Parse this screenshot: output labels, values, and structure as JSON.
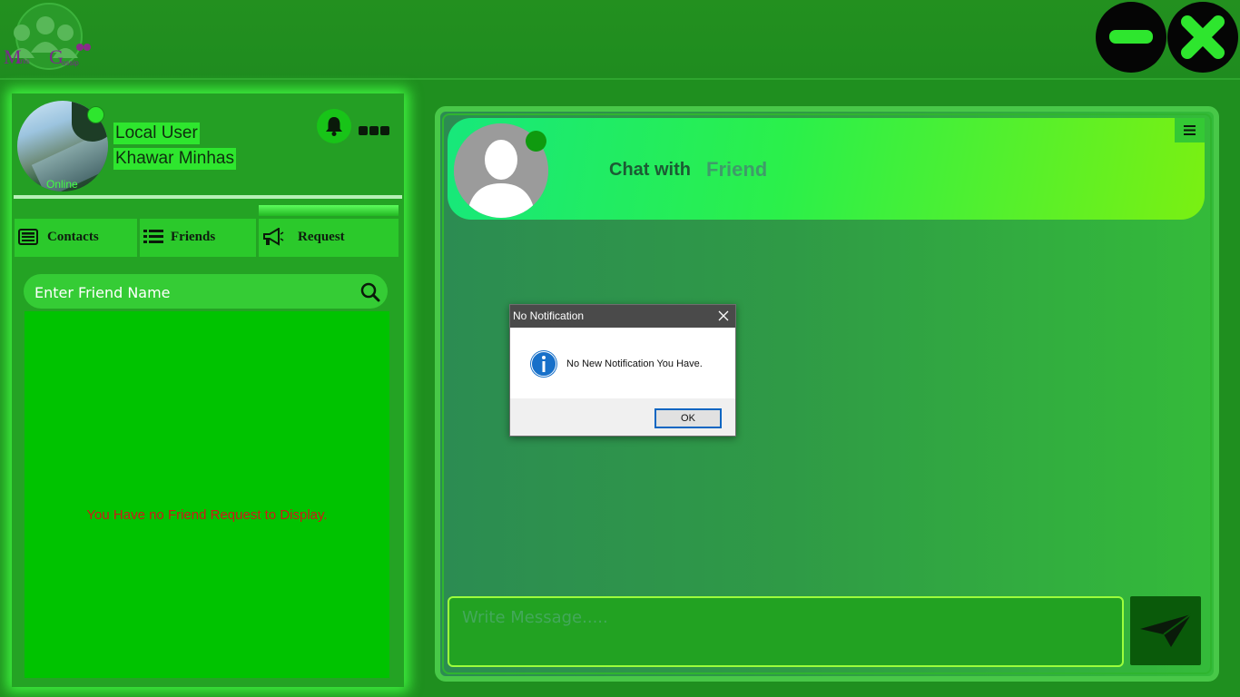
{
  "window": {
    "logo_text": "Manis Gossip",
    "minimize_icon": "minus-icon",
    "close_icon": "close-icon"
  },
  "profile": {
    "status": "Online",
    "user_type": "Local User",
    "user_name": "Khawar Minhas",
    "notification_icon": "bell-icon",
    "more_icon": "more-dots-icon"
  },
  "tabs": [
    {
      "label": "Contacts",
      "icon": "contacts-card-icon"
    },
    {
      "label": "Friends",
      "icon": "list-icon"
    },
    {
      "label": "Request",
      "icon": "megaphone-icon"
    }
  ],
  "search": {
    "placeholder": "Enter Friend Name",
    "value": ""
  },
  "friend_list": {
    "empty_message": "You Have no Friend Request to Display."
  },
  "chat": {
    "title_prefix": "Chat with",
    "friend_name": "Friend",
    "message_placeholder": "Write Message.....",
    "message_value": "",
    "menu_icon": "hamburger-icon",
    "send_icon": "paper-plane-icon"
  },
  "dialog": {
    "title": "No Notification",
    "message": "No New Notification You Have.",
    "ok_label": "OK",
    "icon": "info-icon"
  },
  "colors": {
    "accent_green": "#2ee62e",
    "list_background": "#00c300",
    "empty_message": "#d01818"
  }
}
